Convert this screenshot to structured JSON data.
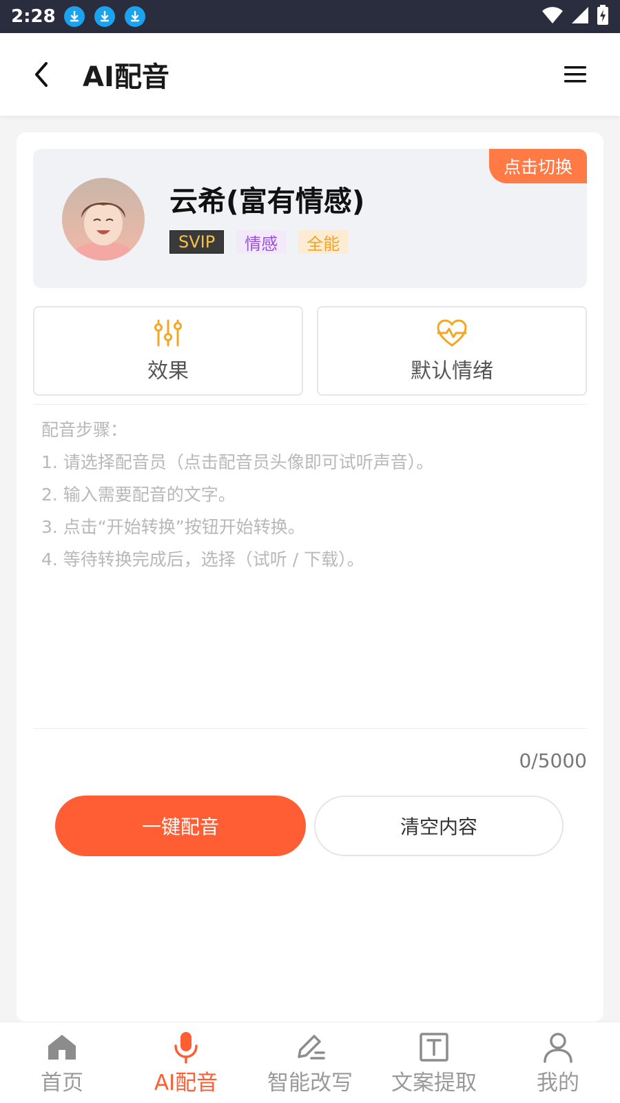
{
  "status_bar": {
    "time": "2:28"
  },
  "header": {
    "title": "AI配音"
  },
  "voice": {
    "name": "云希(富有情感)",
    "switch_label": "点击切换",
    "tags": [
      "SVIP",
      "情感",
      "全能"
    ]
  },
  "options": {
    "effect": "效果",
    "emotion": "默认情绪"
  },
  "editor": {
    "placeholder_lines": [
      "配音步骤：",
      "1. 请选择配音员（点击配音员头像即可试听声音）。",
      "2. 输入需要配音的文字。",
      "3. 点击“开始转换”按钮开始转换。",
      "4. 等待转换完成后，选择（试听 / 下载）。"
    ],
    "char_count": "0/5000"
  },
  "actions": {
    "primary": "一键配音",
    "secondary": "清空内容"
  },
  "bottom_nav": [
    {
      "label": "首页",
      "icon": "home-icon",
      "active": false
    },
    {
      "label": "AI配音",
      "icon": "microphone-icon",
      "active": true
    },
    {
      "label": "智能改写",
      "icon": "edit-icon",
      "active": false
    },
    {
      "label": "文案提取",
      "icon": "text-extract-icon",
      "active": false
    },
    {
      "label": "我的",
      "icon": "user-icon",
      "active": false
    }
  ],
  "colors": {
    "accent": "#ff5e34",
    "badge": "#ff7a45",
    "option_icon": "#f5a623",
    "status_bar": "#2a2d3e"
  }
}
